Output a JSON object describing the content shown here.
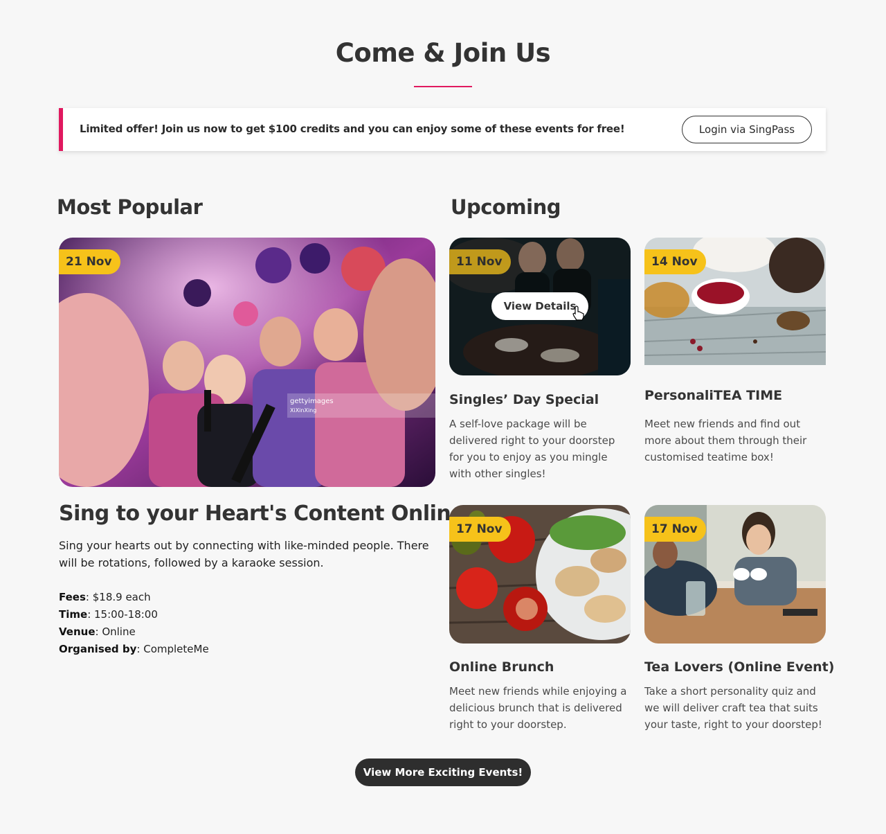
{
  "page": {
    "title": "Come & Join Us"
  },
  "banner": {
    "text": "Limited offer! Join us now to get $100 credits and you can enjoy some of these events for free!",
    "button_label": "Login via SingPass"
  },
  "popular": {
    "heading": "Most Popular",
    "date": "21 Nov",
    "title": "Sing to your Heart's Content Online",
    "description": "Sing your hearts out by connecting with like-minded people. There will be rotations, followed by a karaoke session.",
    "watermark": "gettyimages",
    "watermark_credit": "XiXinXing",
    "details": [
      {
        "label": "Fees",
        "value": ": $18.9 each"
      },
      {
        "label": "Time",
        "value": ": 15:00-18:00"
      },
      {
        "label": "Venue",
        "value": ": Online"
      },
      {
        "label": "Organised by",
        "value": ": CompleteMe"
      }
    ]
  },
  "upcoming": {
    "heading": "Upcoming",
    "view_details_label": "View Details",
    "events": [
      {
        "date": "11 Nov",
        "title": "Singles’ Day Special",
        "description": "A self-love package will be delivered right to your doorstep for you to enjoy as you mingle with other singles!"
      },
      {
        "date": "14 Nov",
        "title": "PersonaliTEA TIME",
        "description": "Meet new friends and find out more about them through their customised teatime box!"
      },
      {
        "date": "17 Nov",
        "title": "Online Brunch",
        "description": "Meet new friends while enjoying a delicious brunch that is delivered right to your doorstep."
      },
      {
        "date": "17 Nov",
        "title": "Tea Lovers (Online Event)",
        "description": "Take a short personality quiz and we will deliver craft tea that suits your taste, right to your doorstep!"
      }
    ]
  },
  "footer": {
    "more_button_label": "View More Exciting Events!"
  },
  "colors": {
    "accent": "#e0195f",
    "badge": "#f6c21a",
    "dark_button": "#2e2e2e"
  }
}
